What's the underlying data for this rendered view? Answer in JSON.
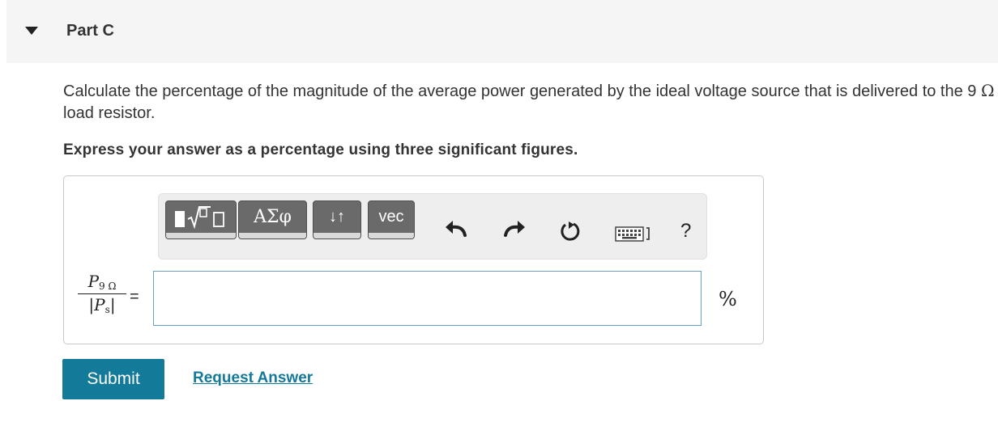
{
  "part": {
    "title": "Part C",
    "toggle_icon": "caret-down-icon"
  },
  "question": {
    "text_before": "Calculate the percentage of the magnitude of the average power generated by the ideal voltage source that is delivered to the 9 ",
    "omega": "Ω",
    "text_after": " load resistor."
  },
  "instruction": "Express your answer as a percentage using three significant figures.",
  "toolbar": {
    "greek_label": "ΑΣφ",
    "arrows_label": "↓↑",
    "vec_label": "vec",
    "help_label": "?",
    "icons": [
      "templates-icon",
      "undo-icon",
      "redo-icon",
      "reset-icon",
      "keyboard-icon",
      "help-icon"
    ]
  },
  "equation": {
    "numerator_var": "P",
    "numerator_sub": "9 Ω",
    "denominator_var": "P",
    "denominator_sub": "s",
    "equals": "=",
    "units": "%",
    "input_value": ""
  },
  "actions": {
    "submit_label": "Submit",
    "request_label": "Request Answer"
  },
  "colors": {
    "accent": "#137a99",
    "header_bg": "#f5f5f5",
    "toolbar_button": "#6a6a6a",
    "input_border": "#6b9fc2"
  }
}
